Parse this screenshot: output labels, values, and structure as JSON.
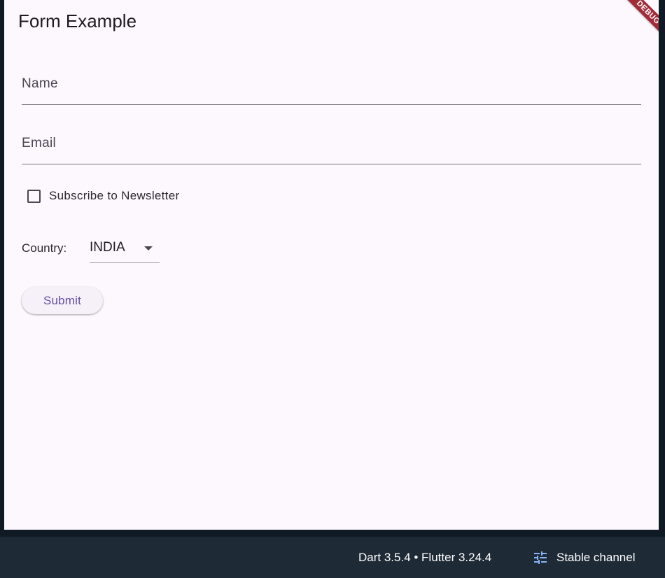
{
  "app": {
    "title": "Form Example",
    "debug_banner": "DEBUG"
  },
  "form": {
    "name_label": "Name",
    "email_label": "Email",
    "newsletter_label": "Subscribe to Newsletter",
    "newsletter_checked": false,
    "country_label": "Country:",
    "country_value": "INDIA",
    "submit_label": "Submit"
  },
  "footer": {
    "versions": "Dart 3.5.4 • Flutter 3.24.4",
    "channel_icon": "tune-icon",
    "channel_label": "Stable channel"
  },
  "colors": {
    "surface": "#fdf7fe",
    "primary": "#6750a4",
    "footer_bg": "#1e2a36",
    "debug_banner": "#a02c3a",
    "icon_accent": "#8ab4f8"
  }
}
